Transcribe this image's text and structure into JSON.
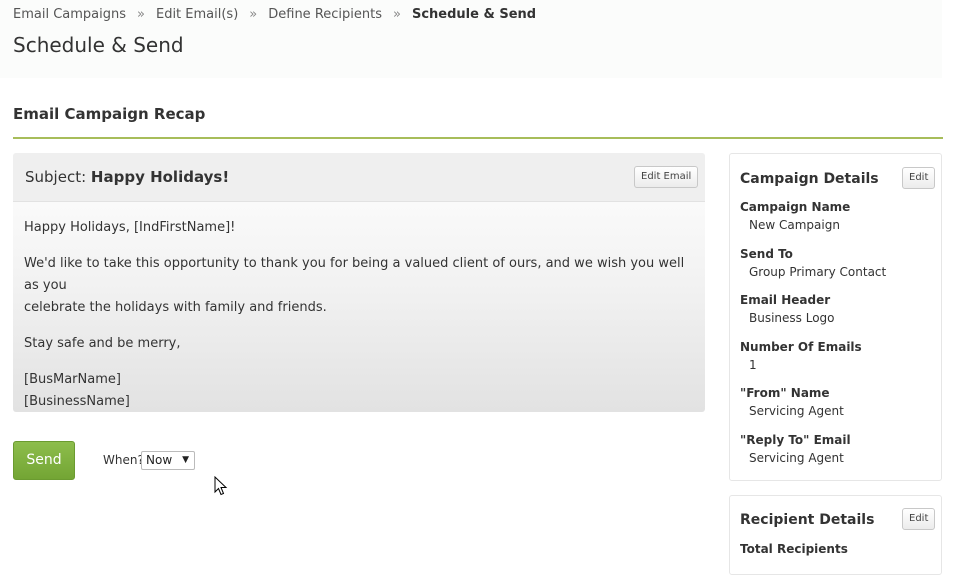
{
  "breadcrumb": {
    "items": [
      "Email Campaigns",
      "Edit Email(s)",
      "Define Recipients"
    ],
    "separator": "»",
    "current": "Schedule & Send"
  },
  "page_title": "Schedule & Send",
  "recap": {
    "title": "Email Campaign Recap",
    "accent_color": "#a7bd5a"
  },
  "email": {
    "subject_label": "Subject:",
    "subject": "Happy Holidays!",
    "edit_button": "Edit Email",
    "body": {
      "greeting": "Happy Holidays, [IndFirstName]!",
      "paragraph": "We'd like to thank you for being a valued client of ours, and we wish you well as you celebrate the holidays with family and friends.",
      "paragraph_line1": "We'd like to take this opportunity to thank you for being a valued client of ours, and we wish you well as you",
      "paragraph_line2": "celebrate the holidays with family and friends.",
      "closing": "Stay safe and be merry,",
      "signature_line1": "[BusMarName]",
      "signature_line2": "[BusinessName]"
    }
  },
  "send": {
    "button": "Send",
    "button_color": "#7fb040",
    "when_label": "When?",
    "when_value": "Now"
  },
  "campaign_details": {
    "title": "Campaign Details",
    "edit_button": "Edit",
    "fields": [
      {
        "label": "Campaign Name",
        "value": "New Campaign"
      },
      {
        "label": "Send To",
        "value": "Group Primary Contact"
      },
      {
        "label": "Email Header",
        "value": "Business Logo"
      },
      {
        "label": "Number Of Emails",
        "value": "1"
      },
      {
        "label": "\"From\" Name",
        "value": "Servicing Agent"
      },
      {
        "label": "\"Reply To\" Email",
        "value": "Servicing Agent"
      }
    ]
  },
  "recipient_details": {
    "title": "Recipient Details",
    "edit_button": "Edit",
    "fields": [
      {
        "label": "Total Recipients"
      }
    ]
  }
}
